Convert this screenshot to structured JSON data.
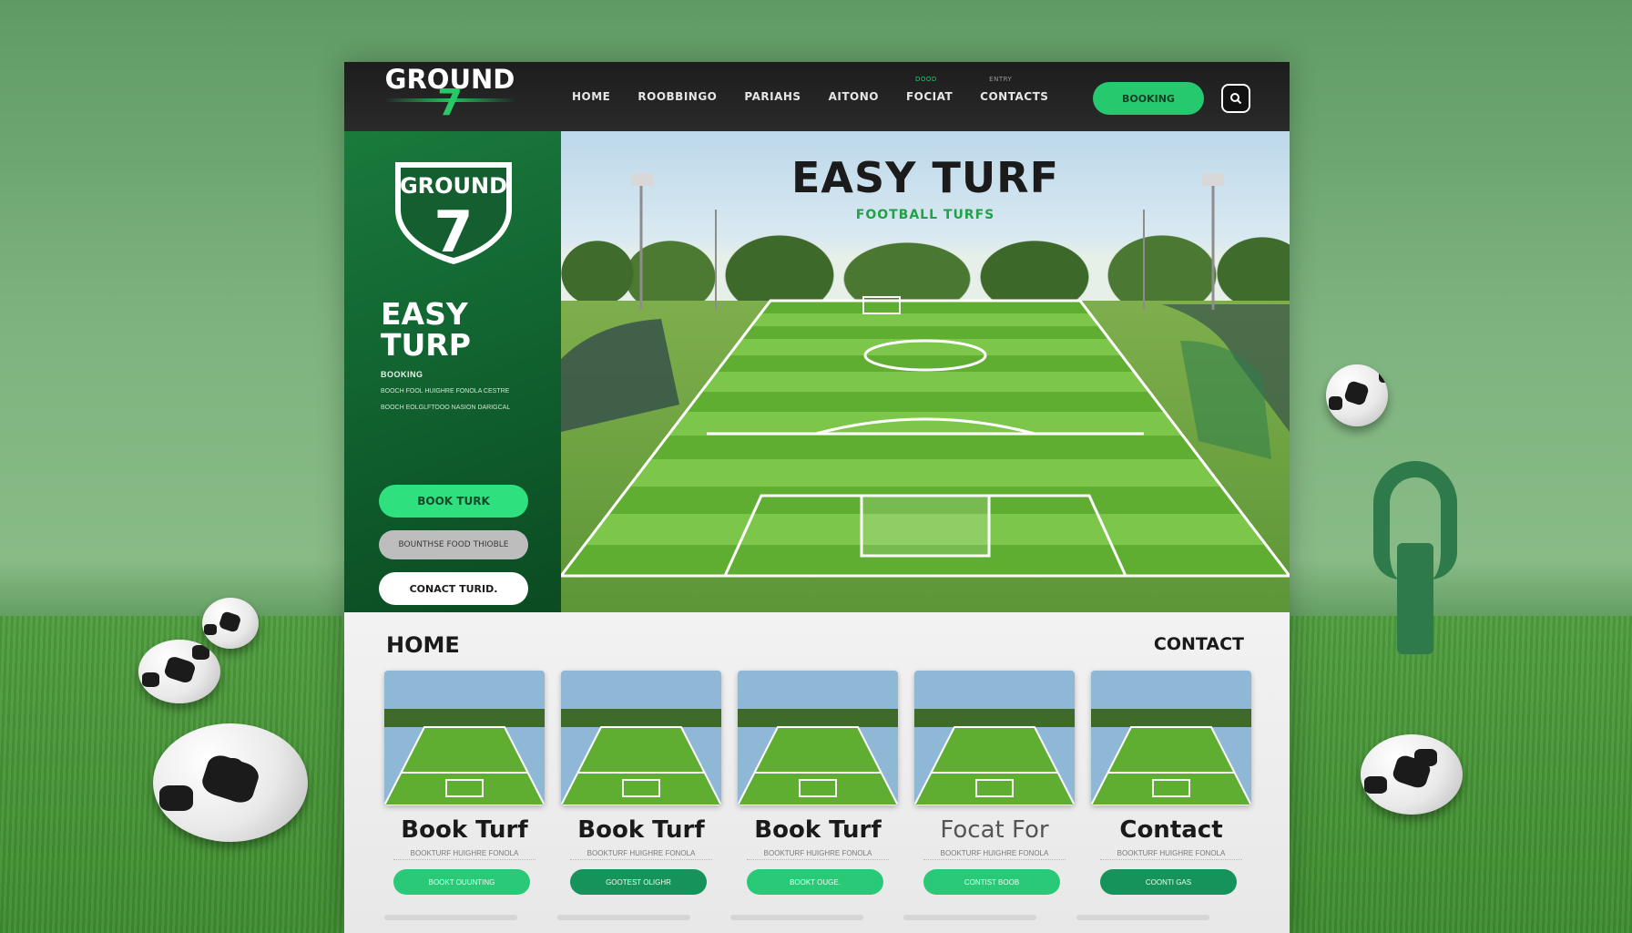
{
  "brand": {
    "name": "GROUND",
    "number": "7",
    "colors": {
      "green": "#29c766",
      "dark": "#1d1d1d",
      "sidebar": "#0f5d2c"
    }
  },
  "nav": {
    "links": [
      {
        "label": "HOME",
        "sup": ""
      },
      {
        "label": "ROOBBINGO",
        "sup": ""
      },
      {
        "label": "PARIAHS",
        "sup": ""
      },
      {
        "label": "AITONO",
        "sup": ""
      },
      {
        "label": "FOCIAT",
        "sup": "DOOD"
      },
      {
        "label": "CONTACTS",
        "sup": "ENTRY"
      }
    ],
    "cta_label": "BOOKING",
    "search_icon": "search-icon"
  },
  "sidebar": {
    "title_line1": "EASY",
    "title_line2": "TURP",
    "subtitle": "BOOKING",
    "line1": "BOOCH FOOL HUIGHRE FONOLA CESTRE",
    "line2": "BOOCH EOLGLFTOOO NASION DARIGCAL",
    "primary_button": "BOOK TURK",
    "secondary_button": "BOUNTHSE FOOD THIOBLE",
    "tertiary_button": "CONACT TURID."
  },
  "hero": {
    "title": "EASY TURF",
    "subtitle": "FOOTBALL TURFS"
  },
  "lower": {
    "home_label": "HOME",
    "contact_label": "CONTACT",
    "cards": [
      {
        "title": "Book Turf",
        "desc": "BOOKTURF HUIGHRE FONOLA",
        "button": "BOOKT OUUNTING"
      },
      {
        "title": "Book Turf",
        "desc": "BOOKTURF HUIGHRE FONOLA",
        "button": "GOOTEST OLIGHR"
      },
      {
        "title": "Book Turf",
        "desc": "BOOKTURF HUIGHRE FONOLA",
        "button": "BOOKT OUGE."
      },
      {
        "title": "Focat For",
        "desc": "BOOKTURF HUIGHRE FONOLA",
        "button": "CONTIST BOOB"
      },
      {
        "title": "Contact",
        "desc": "BOOKTURF HUIGHRE FONOLA",
        "button": "COONTI GAS"
      }
    ]
  }
}
